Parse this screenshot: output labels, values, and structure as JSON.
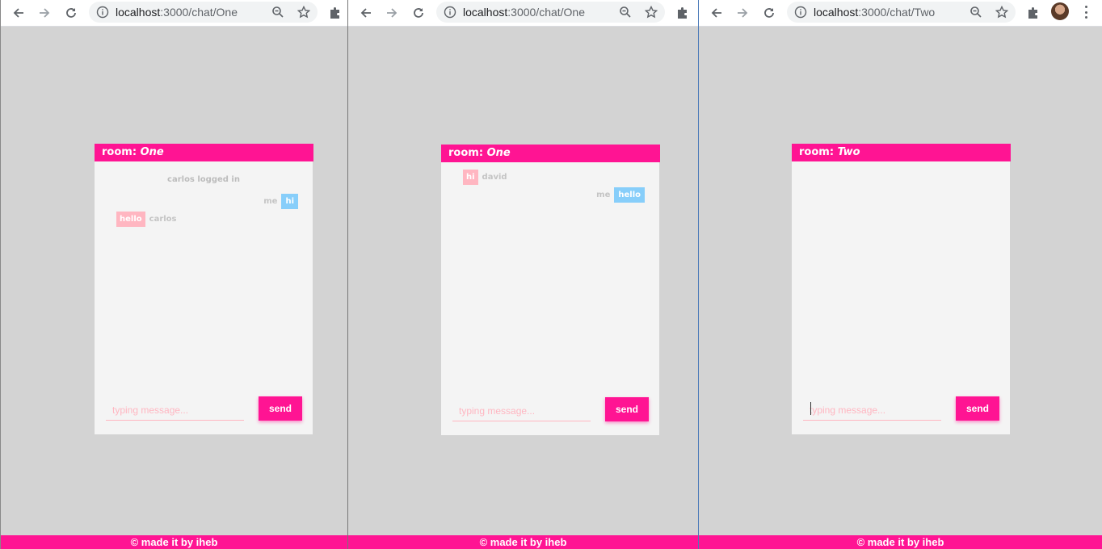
{
  "colors": {
    "accent": "#ff1493",
    "incoming_bubble": "#ffb6c1",
    "outgoing_bubble": "#87cefa",
    "panel_bg": "#f4f4f4",
    "page_bg": "#d3d3d3"
  },
  "windows": [
    {
      "url_host": "localhost",
      "url_path": ":3000/chat/One",
      "room_label": "room:",
      "room_name": "One",
      "system_message": "carlos logged in",
      "messages": [
        {
          "direction": "out",
          "sender": "me",
          "text": "hi"
        },
        {
          "direction": "in",
          "sender": "carlos",
          "text": "hello"
        }
      ],
      "input_placeholder": "typing message...",
      "send_label": "send",
      "footer": "© made it by iheb"
    },
    {
      "url_host": "localhost",
      "url_path": ":3000/chat/One",
      "room_label": "room:",
      "room_name": "One",
      "messages": [
        {
          "direction": "in",
          "sender": "david",
          "text": "hi"
        },
        {
          "direction": "out",
          "sender": "me",
          "text": "hello"
        }
      ],
      "input_placeholder": "typing message...",
      "send_label": "send",
      "footer": "© made it by iheb"
    },
    {
      "url_host": "localhost",
      "url_path": ":3000/chat/Two",
      "room_label": "room:",
      "room_name": "Two",
      "messages": [],
      "input_placeholder": "typing message...",
      "send_label": "send",
      "footer": "© made it by iheb"
    }
  ],
  "icons": [
    "back-arrow-icon",
    "forward-arrow-icon",
    "reload-icon",
    "info-icon",
    "zoom-icon",
    "star-icon",
    "extensions-puzzle-icon",
    "profile-avatar",
    "kebab-menu-icon"
  ]
}
